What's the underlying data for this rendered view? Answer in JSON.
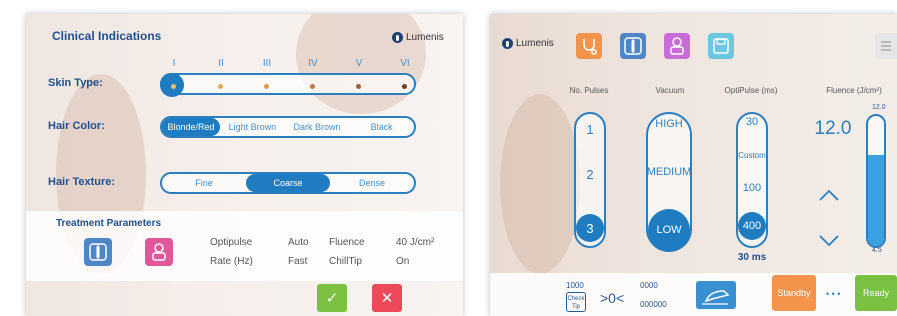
{
  "left": {
    "title": "Clinical Indications",
    "brand": "Lumenis",
    "skin_type": {
      "label": "Skin Type:",
      "numerals": [
        "I",
        "II",
        "III",
        "IV",
        "V",
        "VI"
      ],
      "dot_colors": [
        "#e8c27a",
        "#e0a85c",
        "#d99a55",
        "#b87a45",
        "#a05a35",
        "#6e3a20"
      ],
      "selected": "I"
    },
    "hair_color": {
      "label": "Hair Color:",
      "options": [
        "Blonde/Red",
        "Light Brown",
        "Dark Brown",
        "Black"
      ],
      "selected": "Blonde/Red"
    },
    "hair_texture": {
      "label": "Hair Texture:",
      "options": [
        "Fine",
        "Coarse",
        "Dense"
      ],
      "selected": "Coarse"
    },
    "treatment": {
      "title": "Treatment Parameters",
      "rows": [
        [
          "Optipulse",
          "Auto",
          "Fluence",
          "40 J/cm²"
        ],
        [
          "Rate (Hz)",
          "Fast",
          "ChillTip",
          "On"
        ]
      ]
    },
    "confirm_symbol": "✓",
    "cancel_symbol": "✕"
  },
  "right": {
    "brand": "Lumenis",
    "pulses": {
      "header": "No. Pulses",
      "values": [
        "1",
        "2",
        "3"
      ],
      "selected": "3"
    },
    "vacuum": {
      "header": "Vacuum",
      "values": [
        "HIGH",
        "MEDIUM",
        "LOW"
      ],
      "selected": "LOW"
    },
    "optipulse": {
      "header": "OptiPulse (ms)",
      "values": [
        "30",
        "Custom",
        "100",
        "400"
      ],
      "selected": "400",
      "readout": "30 ms"
    },
    "fluence": {
      "header": "Fluence (J/cm²)",
      "value": "12.0",
      "max": "12.0",
      "min": "4.5",
      "level": 0.7
    },
    "bottom": {
      "counter_top": "1000",
      "check_tip": "Check Tip",
      "zero_indicator": ">0<",
      "counter_right_top": "0000",
      "counter_right_bottom": "000000",
      "standby": "Standby",
      "dots": "• • •",
      "ready": "Ready"
    },
    "colors": {
      "accent": "#1f7cc0",
      "standby": "#f4934a",
      "ready": "#7ac142",
      "fluence_fill": "#3aa0e0"
    }
  }
}
